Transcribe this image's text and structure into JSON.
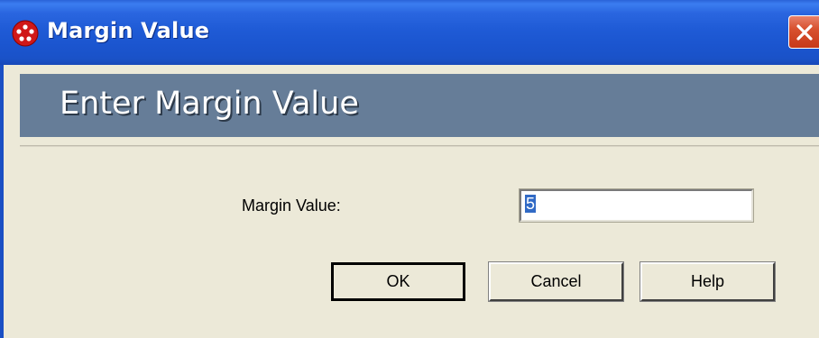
{
  "window": {
    "title": "Margin Value",
    "title_icon": "red-app-icon",
    "close_icon": "close-icon",
    "colors": {
      "titlebar": "#1f5bd6",
      "banner": "#667d98",
      "dialog_bg": "#ece9d8",
      "close_button": "#d8512f"
    }
  },
  "header": {
    "title": "Enter Margin Value"
  },
  "form": {
    "margin_label": "Margin Value:",
    "margin_value": "5"
  },
  "buttons": {
    "ok_label": "OK",
    "cancel_label": "Cancel",
    "help_label": "Help"
  }
}
